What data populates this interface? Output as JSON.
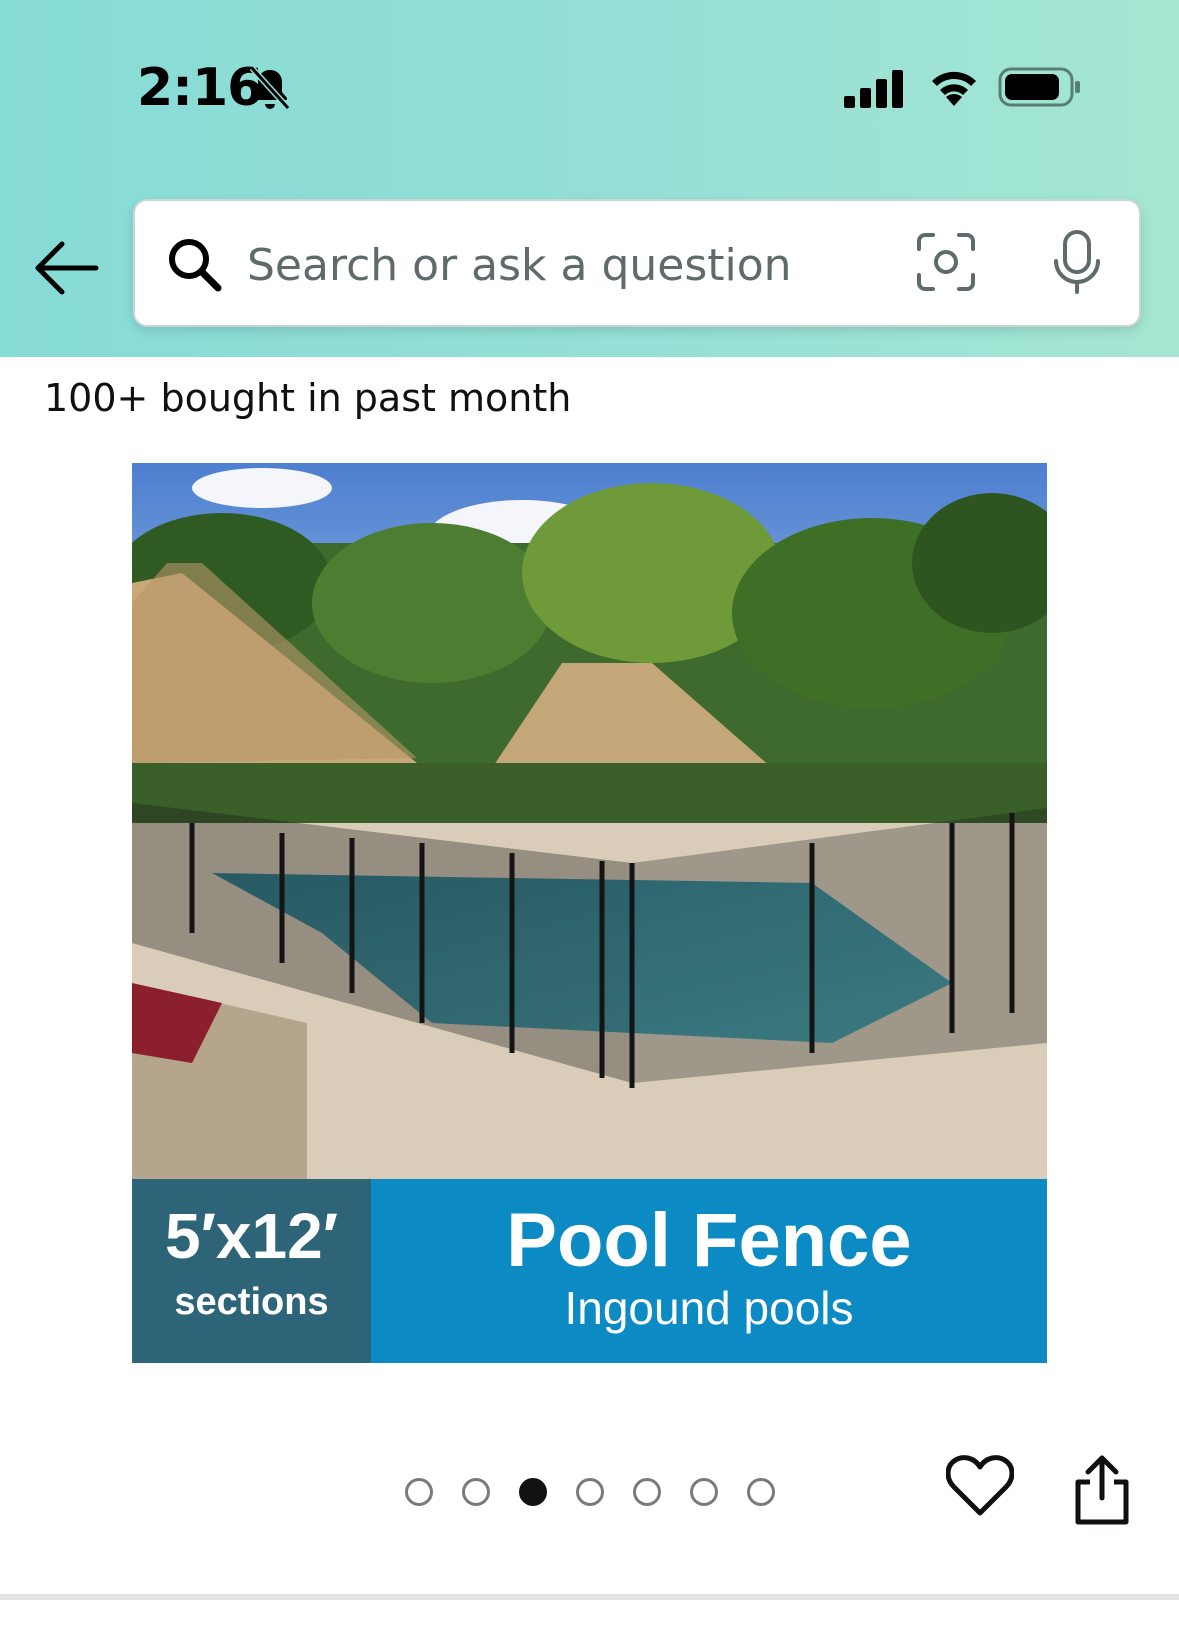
{
  "status_bar": {
    "time": "2:16",
    "icons": [
      "bell-slash-icon",
      "cellular-signal-icon",
      "wifi-icon",
      "battery-icon"
    ]
  },
  "search": {
    "placeholder": "Search or ask a question",
    "icons": [
      "back-arrow-icon",
      "search-icon",
      "camera-scan-icon",
      "microphone-icon"
    ]
  },
  "product": {
    "social_proof": "100+ bought in past month",
    "image_banner": {
      "size": "5′x12′",
      "size_caption": "sections",
      "title": "Pool Fence",
      "subtitle": "Ingound pools"
    },
    "pagination": {
      "total": 7,
      "current_index": 2
    },
    "actions": [
      "heart-icon",
      "share-icon"
    ]
  },
  "colors": {
    "header_gradient_start": "#87dbd6",
    "header_gradient_end": "#a5e6d2",
    "banner_left": "#2e6478",
    "banner_right": "#0b8ac4"
  }
}
